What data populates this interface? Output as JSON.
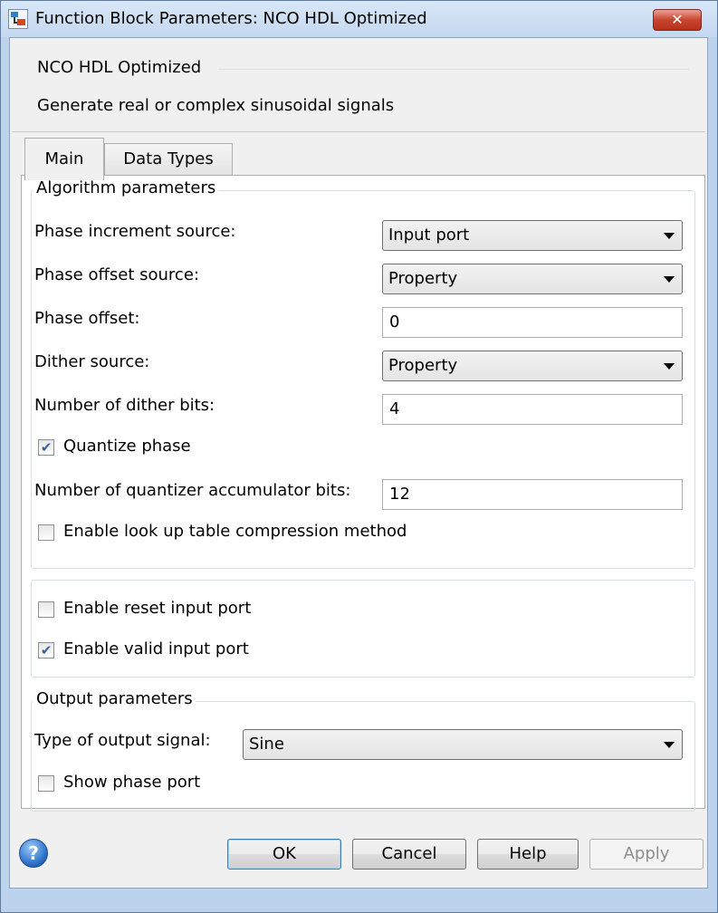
{
  "window": {
    "title": "Function Block Parameters: NCO HDL Optimized",
    "close_glyph": "✕"
  },
  "block": {
    "name": "NCO HDL Optimized",
    "description": "Generate real or complex sinusoidal signals"
  },
  "tabs": [
    {
      "label": "Main",
      "selected": true
    },
    {
      "label": "Data Types",
      "selected": false
    }
  ],
  "algorithm": {
    "legend": "Algorithm parameters",
    "phase_increment_source": {
      "label": "Phase increment source:",
      "value": "Input port"
    },
    "phase_offset_source": {
      "label": "Phase offset source:",
      "value": "Property"
    },
    "phase_offset": {
      "label": "Phase offset:",
      "value": "0"
    },
    "dither_source": {
      "label": "Dither source:",
      "value": "Property"
    },
    "dither_bits": {
      "label": "Number of dither bits:",
      "value": "4"
    },
    "quantize_phase": {
      "label": "Quantize phase",
      "checked": true
    },
    "quantizer_bits": {
      "label": "Number of quantizer accumulator bits:",
      "value": "12"
    },
    "lut_compression": {
      "label": "Enable look up table compression method",
      "checked": false
    }
  },
  "ports": {
    "reset": {
      "label": "Enable reset input port",
      "checked": false
    },
    "valid": {
      "label": "Enable valid input port",
      "checked": true
    }
  },
  "output": {
    "legend": "Output parameters",
    "signal_type": {
      "label": "Type of output signal:",
      "value": "Sine"
    },
    "show_phase": {
      "label": "Show phase port",
      "checked": false
    }
  },
  "buttons": {
    "help_glyph": "?",
    "ok": "OK",
    "cancel": "Cancel",
    "help": "Help",
    "apply": "Apply"
  },
  "colors": {
    "window_frame": "#bcd3ee",
    "close_button": "#c8452f",
    "check_mark": "#3a5fa0"
  },
  "check_glyph": "✔"
}
